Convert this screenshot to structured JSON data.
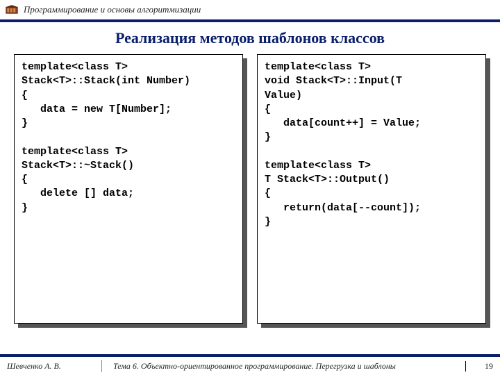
{
  "header": {
    "course": "Программирование и основы алгоритмизации"
  },
  "title": "Реализация методов шаблонов классов",
  "code": {
    "left": "template<class T>\nStack<T>::Stack(int Number)\n{\n   data = new T[Number];\n}\n\ntemplate<class T>\nStack<T>::~Stack()\n{\n   delete [] data;\n}",
    "right": "template<class T>\nvoid Stack<T>::Input(T\nValue)\n{\n   data[count++] = Value;\n}\n\ntemplate<class T>\nT Stack<T>::Output()\n{\n   return(data[--count]);\n}"
  },
  "footer": {
    "author": "Шевченко А. В.",
    "topic": "Тема 6. Объектно-ориентированное программирование. Перегрузка и шаблоны",
    "page": "19"
  }
}
